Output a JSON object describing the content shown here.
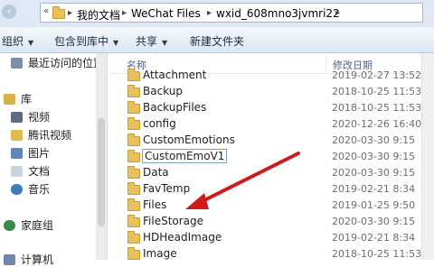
{
  "address": {
    "crumbs": [
      "«",
      "我的文档",
      "WeChat Files",
      "wxid_608mno3jvmri22"
    ]
  },
  "toolbar": {
    "organize": "组织",
    "include_in_library": "包含到库中",
    "share": "共享",
    "new_folder": "新建文件夹"
  },
  "nav": {
    "recent": "最近访问的位置",
    "library": "库",
    "video": "视频",
    "tencent_video": "腾讯视频",
    "pictures": "图片",
    "documents": "文档",
    "music": "音乐",
    "homegroup": "家庭组",
    "computer": "计算机"
  },
  "columns": {
    "name": "名称",
    "modified": "修改日期"
  },
  "files": [
    {
      "name": "Attachment",
      "date": "2019-02-27 13:52"
    },
    {
      "name": "Backup",
      "date": "2018-10-25 11:53"
    },
    {
      "name": "BackupFiles",
      "date": "2018-10-25 11:53"
    },
    {
      "name": "config",
      "date": "2020-12-26 16:40"
    },
    {
      "name": "CustomEmotions",
      "date": "2020-03-30 9:15"
    },
    {
      "name": "CustomEmoV1",
      "date": "2020-03-30 9:15"
    },
    {
      "name": "Data",
      "date": "2020-03-30 9:15"
    },
    {
      "name": "FavTemp",
      "date": "2019-02-21 8:34"
    },
    {
      "name": "Files",
      "date": "2019-01-25 9:50"
    },
    {
      "name": "FileStorage",
      "date": "2020-03-30 9:15"
    },
    {
      "name": "HDHeadImage",
      "date": "2019-02-21 8:34"
    },
    {
      "name": "Image",
      "date": "2018-10-25 11:53"
    }
  ],
  "colors": {
    "folder": "#e9c15a",
    "arrow": "#d11a1a",
    "header_text": "#4d6185"
  }
}
